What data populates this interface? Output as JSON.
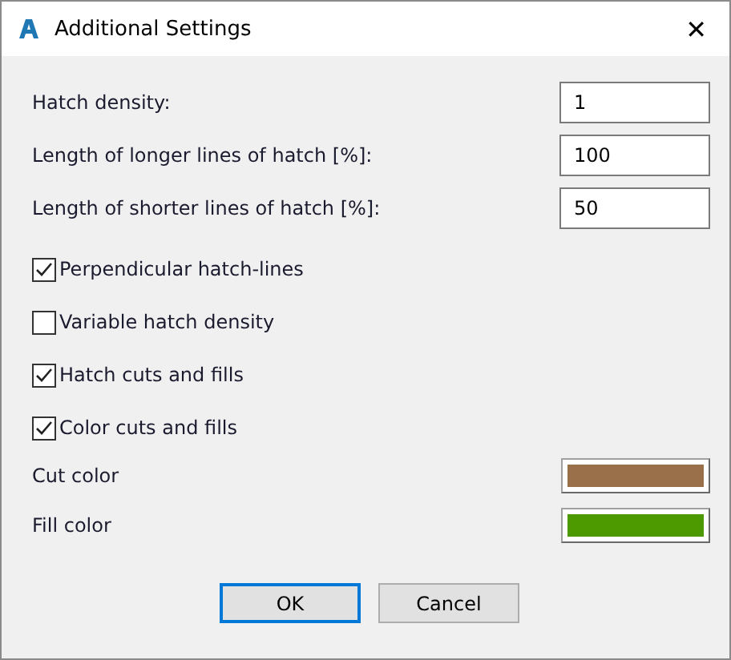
{
  "window": {
    "title": "Additional Settings",
    "close": "✕"
  },
  "fields": [
    {
      "label": "Hatch density:",
      "value": "1"
    },
    {
      "label": "Length of longer lines of hatch [%]:",
      "value": "100"
    },
    {
      "label": "Length of shorter lines of hatch [%]:",
      "value": "50"
    }
  ],
  "checkboxes": [
    {
      "label": "Perpendicular hatch-lines",
      "checked": true
    },
    {
      "label": "Variable hatch density",
      "checked": false
    },
    {
      "label": "Hatch cuts and fills",
      "checked": true
    },
    {
      "label": "Color cuts and fills",
      "checked": true
    }
  ],
  "colors": [
    {
      "label": "Cut color",
      "color": "#9a704a"
    },
    {
      "label": "Fill color",
      "color": "#4c9a00"
    }
  ],
  "buttons": [
    {
      "label": "OK",
      "selected": true
    },
    {
      "label": "Cancel",
      "selected": false
    }
  ]
}
